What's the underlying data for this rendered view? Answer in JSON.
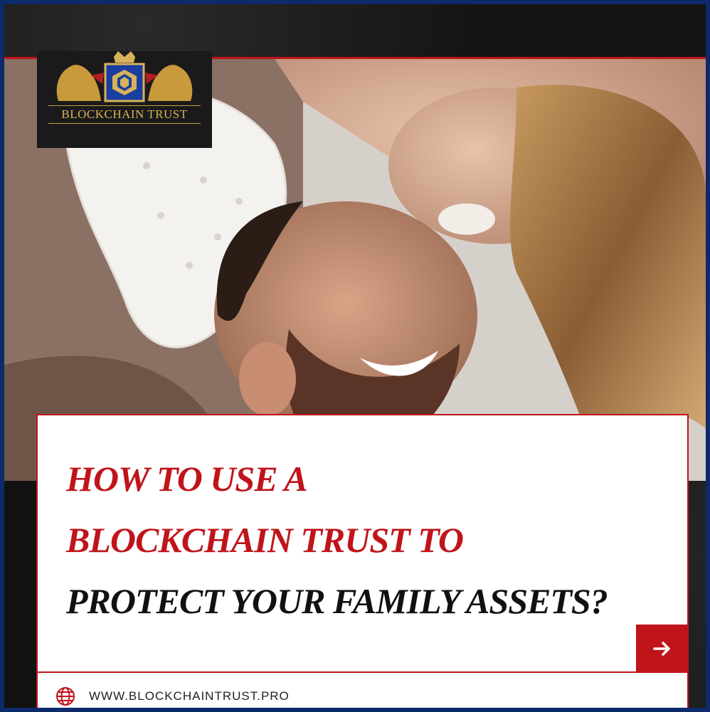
{
  "brand": {
    "logo_text": "BLOCKCHAIN TRUST"
  },
  "headline": {
    "line1": "HOW TO USE A",
    "line2": "BLOCKCHAIN TRUST TO",
    "line3": "PROTECT YOUR FAMILY ASSETS?"
  },
  "footer": {
    "url": "WWW.BLOCKCHAINTRUST.PRO",
    "icon": "globe-icon"
  },
  "cta": {
    "icon": "arrow-right-icon"
  },
  "colors": {
    "accent_red": "#c0141b",
    "frame_blue": "#0d2a6b",
    "gold": "#d7b25a"
  }
}
